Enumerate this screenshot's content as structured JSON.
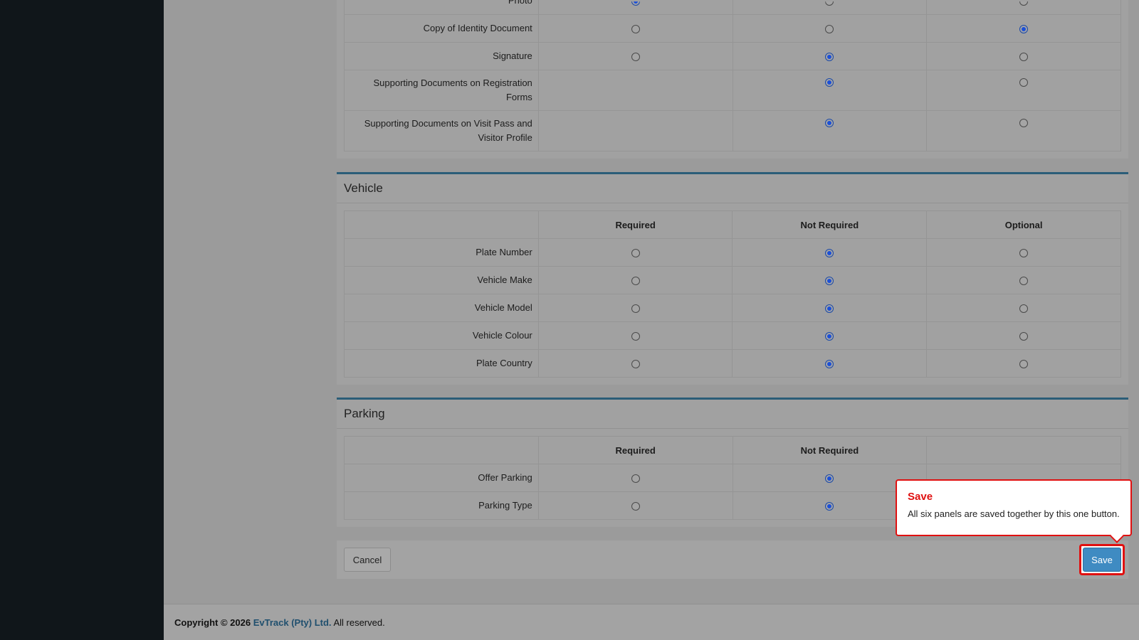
{
  "documents": {
    "rows": [
      {
        "label": "Photo",
        "required": true,
        "not_required": false,
        "optional": false
      },
      {
        "label": "Copy of Identity Document",
        "required": false,
        "not_required": false,
        "optional": true
      },
      {
        "label": "Signature",
        "required": false,
        "not_required": true,
        "optional": false
      },
      {
        "label": "Supporting Documents on Registration Forms",
        "required": null,
        "not_required": true,
        "optional": false
      },
      {
        "label": "Supporting Documents on Visit Pass and Visitor Profile",
        "required": null,
        "not_required": true,
        "optional": false
      }
    ]
  },
  "vehicle": {
    "title": "Vehicle",
    "columns": {
      "required": "Required",
      "not_required": "Not Required",
      "optional": "Optional"
    },
    "rows": [
      {
        "label": "Plate Number",
        "selected": "not_required"
      },
      {
        "label": "Vehicle Make",
        "selected": "not_required"
      },
      {
        "label": "Vehicle Model",
        "selected": "not_required"
      },
      {
        "label": "Vehicle Colour",
        "selected": "not_required"
      },
      {
        "label": "Plate Country",
        "selected": "not_required"
      }
    ]
  },
  "parking": {
    "title": "Parking",
    "columns": {
      "required": "Required",
      "not_required": "Not Required"
    },
    "rows": [
      {
        "label": "Offer Parking",
        "selected": "not_required"
      },
      {
        "label": "Parking Type",
        "selected": "not_required"
      }
    ]
  },
  "actions": {
    "cancel_label": "Cancel",
    "save_label": "Save"
  },
  "tooltip": {
    "title": "Save",
    "body": "All six panels are saved together by this one button."
  },
  "footer": {
    "copyright": "Copyright © 2026",
    "company": "EvTrack (Pty) Ltd.",
    "rights": "All reserved."
  },
  "colors": {
    "accent": "#2b5d78",
    "save_button": "#3f8bc2",
    "highlight": "#e01010",
    "sidebar": "#10161a"
  }
}
